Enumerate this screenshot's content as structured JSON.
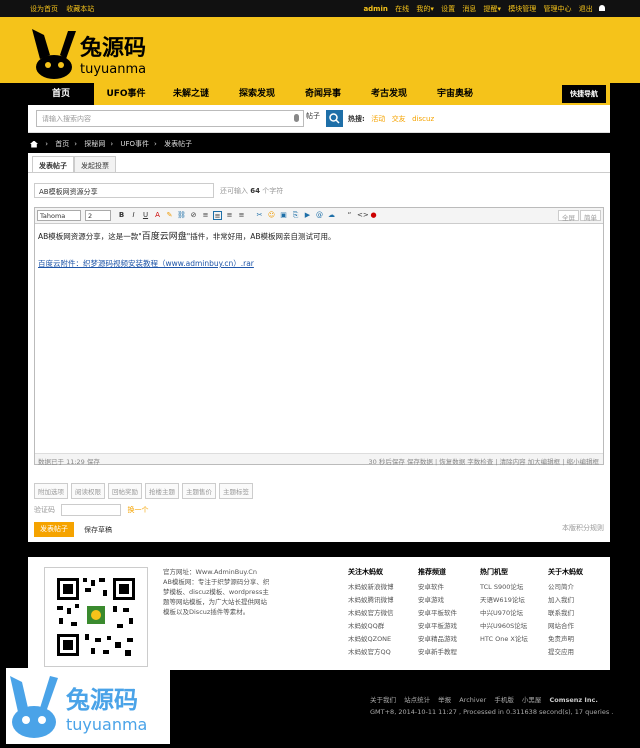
{
  "topbar": {
    "left": [
      "设为首页",
      "收藏本站"
    ],
    "user": "admin",
    "right": [
      "在线",
      "我的▾",
      "设置",
      "消息",
      "提醒▾",
      "模块管理",
      "管理中心",
      "退出"
    ]
  },
  "logo": {
    "cn": "兔源码",
    "en": "tuyuanma"
  },
  "nav": {
    "items": [
      "首页",
      "UFO事件",
      "未解之谜",
      "探索发现",
      "奇闻异事",
      "考古发现",
      "宇宙奥秘"
    ],
    "quick": "快捷导航"
  },
  "search": {
    "placeholder": "请输入搜索内容",
    "type": "帖子",
    "hot_label": "热搜:",
    "hot": [
      "活动",
      "交友",
      "discuz"
    ]
  },
  "breadcrumb": [
    "首页",
    "探秘网",
    "UFO事件",
    "发表帖子"
  ],
  "tabs": [
    "发表帖子",
    "发起投票"
  ],
  "post": {
    "title": "AB模板网资源分享",
    "remain_pre": "还可输入",
    "remain_num": "64",
    "remain_post": "个字符"
  },
  "toolbar": {
    "font": "Tahoma",
    "size": "2",
    "fullscreen": "全屏",
    "simple": "简单"
  },
  "content": {
    "line1a": "AB模板网资源分享，这是一款\"",
    "line1b": "百度云网盘",
    "line1c": "\"插件，非常好用，AB模板网亲自测试可用。",
    "link": "百度云附件：织梦源码视频安装教程（www.adminbuy.cn）.rar"
  },
  "status": {
    "left": "数据已于 11:29 保存",
    "right": "30 秒后保存 保存数据 | 恢复数据    字数检查 | 清除内容    加大编辑框 | 缩小编辑框"
  },
  "options": [
    "附加选项",
    "阅读权限",
    "回帖奖励",
    "抢楼主题",
    "主题售价",
    "主题标签"
  ],
  "verify": {
    "label": "验证码",
    "switch": "换一个"
  },
  "submit": "发表帖子",
  "draft": "保存草稿",
  "rules": "本版积分规则",
  "footer": {
    "info": [
      "官方网址：Www.AdminBuy.Cn",
      "AB模板网：专注于织梦源码分享、织梦模板、discuz模板、wordpress主题等网站模板，为广大站长提供网站模板以及Discuz插件等素材。"
    ],
    "cols": [
      {
        "title": "关注木蚂蚁",
        "items": [
          "木蚂蚁新浪微博",
          "木蚂蚁腾讯微博",
          "木蚂蚁官方微信",
          "木蚂蚁QQ群",
          "木蚂蚁QZONE",
          "木蚂蚁官方QQ"
        ]
      },
      {
        "title": "推荐频道",
        "items": [
          "安卓软件",
          "安卓游戏",
          "安卓平板软件",
          "安卓平板游戏",
          "安卓精品游戏",
          "安卓新手教程"
        ]
      },
      {
        "title": "热门机型",
        "items": [
          "TCL S900论坛",
          "天语W619论坛",
          "中兴U970论坛",
          "中兴U960S论坛",
          "HTC One X论坛"
        ]
      },
      {
        "title": "关于木蚂蚁",
        "items": [
          "公司简介",
          "加入我们",
          "联系我们",
          "网站合作",
          "免责声明",
          "提交应用"
        ]
      }
    ]
  },
  "bottom": {
    "links": [
      "关于我们",
      "站点统计",
      "举报",
      "Archiver",
      "手机版",
      "小黑屋",
      "Comsenz Inc."
    ],
    "meta": "GMT+8, 2014-10-11 11:27 , Processed in 0.311638 second(s), 17 queries ."
  },
  "watermark": {
    "cn": "兔源码",
    "en": "tuyuanma"
  },
  "colors": {
    "brand": "#f5c31a",
    "accent": "#f5a300",
    "link": "#1e55a8"
  }
}
